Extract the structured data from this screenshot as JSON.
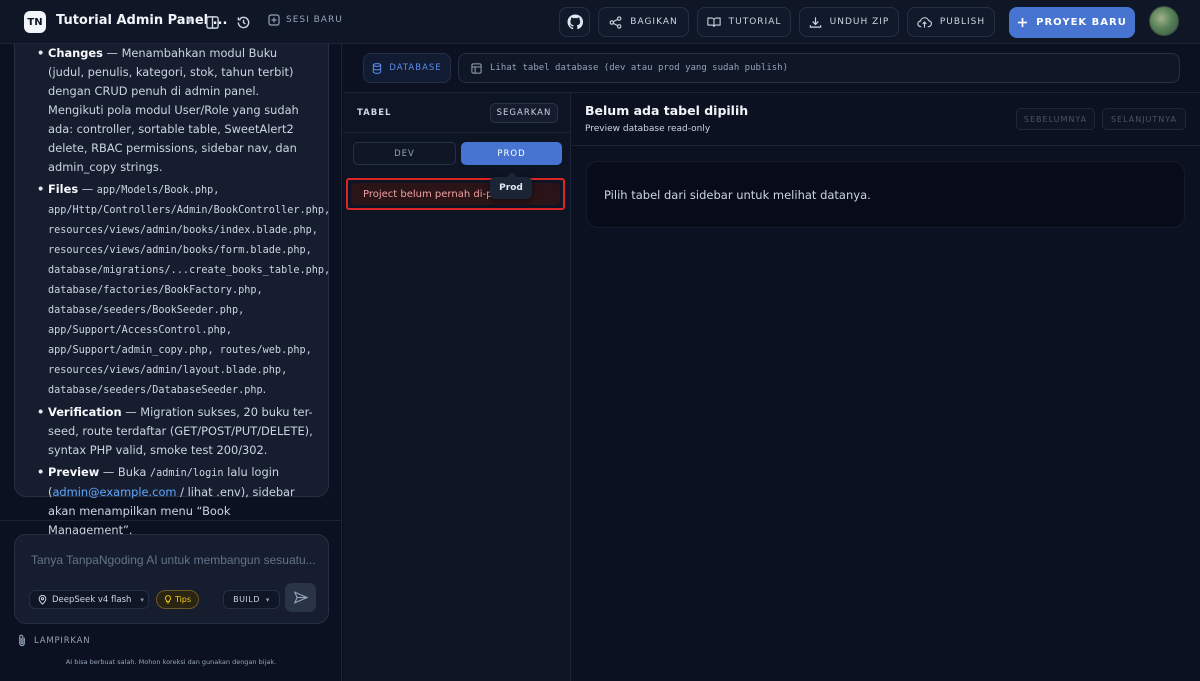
{
  "app": {
    "logo_text": "TN",
    "project_title": "Tutorial Admin Panel ...",
    "new_session": "SESI BARU"
  },
  "toolbar": {
    "share": "BAGIKAN",
    "tutorial": "TUTORIAL",
    "download_zip": "UNDUH ZIP",
    "publish": "PUBLISH",
    "new_project": "PROYEK BARU"
  },
  "chat": {
    "message_items": [
      {
        "label": "Changes",
        "sep": " — ",
        "text": "Menambahkan modul Buku (judul, penulis, kategori, stok, tahun terbit) dengan CRUD penuh di admin panel. Mengikuti pola modul User/Role yang sudah ada: controller, sortable table, SweetAlert2 delete, RBAC permissions, sidebar nav, dan admin_copy strings."
      },
      {
        "label": "Files",
        "sep": " — ",
        "mono": "app/Models/Book.php, app/Http/Controllers/Admin/BookController.php, resources/views/admin/books/index.blade.php, resources/views/admin/books/form.blade.php, database/migrations/...create_books_table.php, database/factories/BookFactory.php, database/seeders/BookSeeder.php, app/Support/AccessControl.php, app/Support/admin_copy.php, routes/web.php, resources/views/admin/layout.blade.php, database/seeders/DatabaseSeeder.php",
        "end": "."
      },
      {
        "label": "Verification",
        "sep": " — ",
        "text": "Migration sukses, 20 buku ter-seed, route terdaftar (GET/POST/PUT/DELETE), syntax PHP valid, smoke test 200/302."
      },
      {
        "label": "Preview",
        "sep": " — ",
        "text_a": "Buka ",
        "mono_a": "/admin/login",
        "text_b": " lalu login (",
        "link": "admin@example.com",
        "text_c": " / lihat .env), sidebar akan menampilkan menu “Book Management”."
      }
    ],
    "input_placeholder": "Tanya TanpaNgoding AI untuk membangun sesuatu...",
    "model": "DeepSeek v4 flash",
    "tips": "Tips",
    "mode": "BUILD",
    "attach": "LAMPIRKAN",
    "disclaimer": "AI bisa berbuat salah. Mohon koreksi dan gunakan dengan bijak."
  },
  "database": {
    "tab": "DATABASE",
    "info": "Lihat tabel database (dev atau prod yang sudah publish)",
    "sidebar_title": "TABEL",
    "refresh": "SEGARKAN",
    "env_dev": "DEV",
    "env_prod": "PROD",
    "notice": "Project belum pernah di-publish",
    "tooltip": "Prod",
    "main_title": "Belum ada tabel dipilih",
    "main_subtitle": "Preview database read-only",
    "prev": "SEBELUMNYA",
    "next": "SELANJUTNYA",
    "empty_message": "Pilih tabel dari sidebar untuk melihat datanya."
  },
  "colors": {
    "accent": "#4674d0",
    "background": "#0b1120",
    "error_border": "#dc2626"
  }
}
